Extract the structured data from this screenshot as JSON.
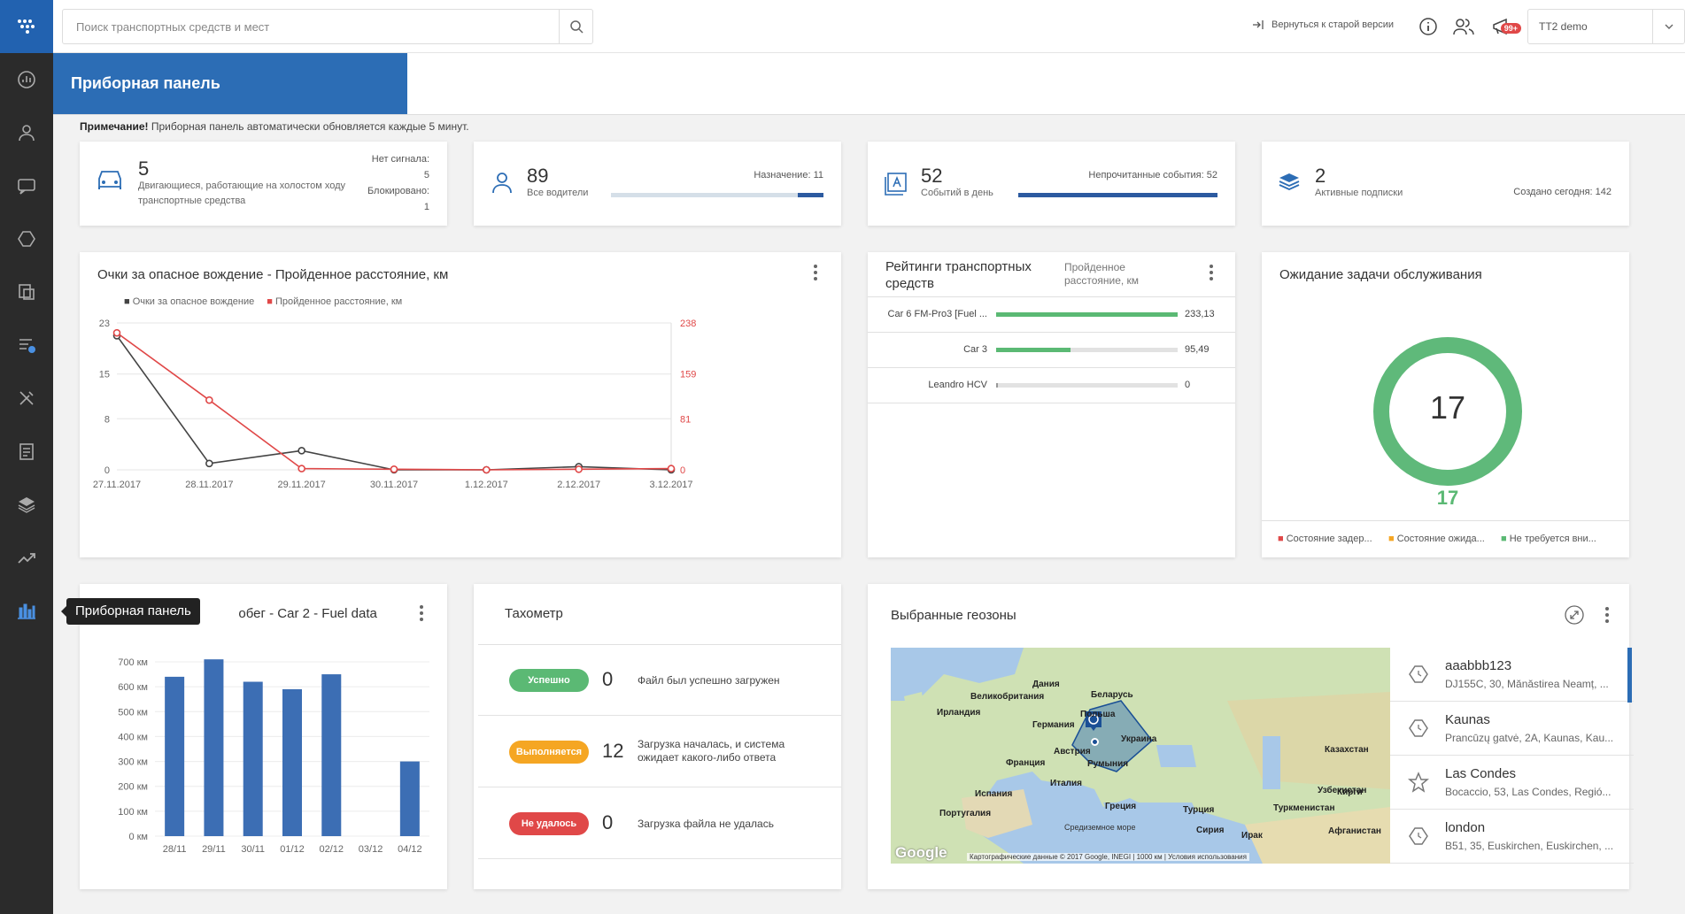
{
  "colors": {
    "brand": "#2c6db5",
    "sidebar": "#2b2b2b",
    "green": "#5bb974",
    "red": "#e04848",
    "orange": "#f5a623",
    "series_dark": "#444444",
    "series_red": "#e04848"
  },
  "sidebar": {
    "items": [
      "dashboard-icon",
      "driver-icon",
      "chat-icon",
      "geozone-icon",
      "documents-icon",
      "route-icon",
      "tools-icon",
      "tasks-icon",
      "layers-icon",
      "trend-icon",
      "bar-chart-icon"
    ],
    "tooltip": "Приборная панель"
  },
  "topbar": {
    "search_placeholder": "Поиск транспортных средств и мест",
    "back_link": "Вернуться к старой версии",
    "notifications_badge": "99+",
    "user": "TT2 demo"
  },
  "page": {
    "title": "Приборная панель",
    "note_bold": "Примечание!",
    "note_text": " Приборная панель автоматически обновляется каждые 5 минут."
  },
  "stats": {
    "vehicles": {
      "num": "5",
      "label": "Двигающиеся, работающие на холостом ходу транспортные средства",
      "no_signal_label": "Нет сигнала:",
      "no_signal": "5",
      "blocked_label": "Блокировано:",
      "blocked": "1"
    },
    "drivers": {
      "num": "89",
      "label": "Все водители",
      "assigned_label": "Назначение:",
      "assigned": "11",
      "assigned_fraction": 0.12
    },
    "events": {
      "num": "52",
      "label": "Событий в день",
      "unread_label": "Непрочитанные события:",
      "unread": "52",
      "unread_fraction": 1.0
    },
    "subs": {
      "num": "2",
      "label": "Активные подписки",
      "today_label": "Создано сегодня:",
      "today": "142"
    }
  },
  "line_card": {
    "title": "Очки за опасное вождение - Пройденное расстояние, км",
    "legend": [
      "Очки за опасное вождение",
      "Пройденное расстояние, км"
    ],
    "left_ticks": [
      "23",
      "15",
      "8",
      "0"
    ],
    "right_ticks": [
      "238",
      "159",
      "81",
      "0"
    ]
  },
  "ratings": {
    "title": "Рейтинги транспортных средств",
    "subtitle": "Пройденное расстояние, км",
    "rows": [
      {
        "name": "Car 6 FM-Pro3 [Fuel ...",
        "value": "233,13",
        "fraction": 1.0
      },
      {
        "name": "Car 3",
        "value": "95,49",
        "fraction": 0.41
      },
      {
        "name": "Leandro HCV",
        "value": "0",
        "fraction": 0.0
      }
    ]
  },
  "maintenance": {
    "title": "Ожидание задачи обслуживания",
    "center": "17",
    "total": "17",
    "legend": [
      "Состояние задер...",
      "Состояние ожида...",
      "Не требуется вни..."
    ]
  },
  "fuel_card": {
    "title": "Пробег - Car 2 - Fuel data"
  },
  "tach": {
    "title": "Тахометр",
    "rows": [
      {
        "status": "Успешно",
        "count": "0",
        "text": "Файл был успешно загружен"
      },
      {
        "status": "Выполняется",
        "count": "12",
        "text": "Загрузка началась, и система ожидает какого-либо ответа"
      },
      {
        "status": "Не удалось",
        "count": "0",
        "text": "Загрузка файла не удалась"
      }
    ]
  },
  "geo": {
    "title": "Выбранные геозоны",
    "items": [
      {
        "name": "aaabbb123",
        "addr": "DJ155C, 30, Mănăstirea Neamț, ...",
        "icon": "geozone-icon"
      },
      {
        "name": "Kaunas",
        "addr": "Prancūzų gatvė, 2A, Kaunas, Kau...",
        "icon": "geozone-icon"
      },
      {
        "name": "Las Condes",
        "addr": "Bocaccio, 53, Las Condes, Regió...",
        "icon": "star-icon"
      },
      {
        "name": "london",
        "addr": "B51, 35, Euskirchen, Euskirchen, ...",
        "icon": "geozone-icon"
      }
    ],
    "map_labels": [
      "Дания",
      "Беларусь",
      "Великобритания",
      "Польша",
      "Ирландия",
      "Украина",
      "Германия",
      "Франция",
      "Австрия",
      "Румыния",
      "Казахстан",
      "Италия",
      "Испания",
      "Португалия",
      "Греция",
      "Турция",
      "Узбекистан",
      "Туркменистан",
      "Кирги",
      "Афганистан",
      "Сирия",
      "Ирак",
      "Средиземное море"
    ],
    "map_footer": "Картографические данные © 2017 Google, INEGI",
    "map_scale": "1000 км",
    "map_terms": "Условия использования",
    "google": "Google"
  },
  "chart_data": [
    {
      "type": "line",
      "title": "Очки за опасное вождение - Пройденное расстояние, км",
      "categories": [
        "27.11.2017",
        "28.11.2017",
        "29.11.2017",
        "30.11.2017",
        "1.12.2017",
        "2.12.2017",
        "3.12.2017"
      ],
      "series": [
        {
          "name": "Очки за опасное вождение",
          "axis": "left",
          "values": [
            21,
            1,
            3,
            0,
            0,
            0.5,
            0
          ]
        },
        {
          "name": "Пройденное расстояние, км",
          "axis": "right",
          "values": [
            222,
            113,
            2,
            1,
            0,
            1,
            2
          ]
        }
      ],
      "ylim_left": [
        0,
        23
      ],
      "ylim_right": [
        0,
        238
      ],
      "legend": "top-left",
      "grid": true
    },
    {
      "type": "bar",
      "title": "Пробег - Car 2 - Fuel data",
      "categories": [
        "28/11",
        "29/11",
        "30/11",
        "01/12",
        "02/12",
        "03/12",
        "04/12"
      ],
      "values": [
        640,
        710,
        620,
        590,
        650,
        0,
        300
      ],
      "y_ticks": [
        "0 км",
        "100 км",
        "200 км",
        "300 км",
        "400 км",
        "500 км",
        "600 км",
        "700 км"
      ],
      "ylim": [
        0,
        700
      ],
      "grid": true
    }
  ]
}
